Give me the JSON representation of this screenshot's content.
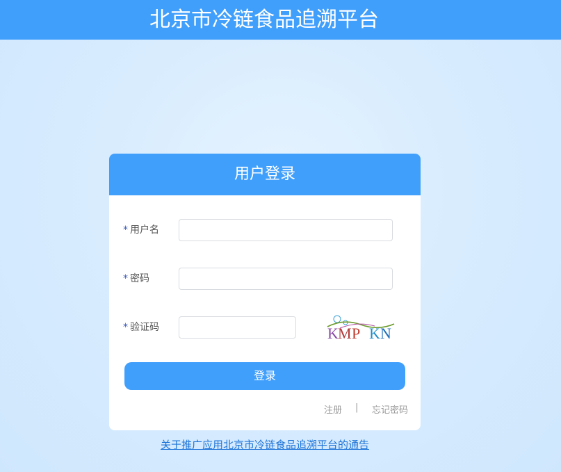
{
  "header": {
    "title": "北京市冷链食品追溯平台"
  },
  "login_card": {
    "title": "用户登录",
    "required_mark": "*",
    "username": {
      "label": "用户名",
      "value": "",
      "placeholder": ""
    },
    "password": {
      "label": "密码",
      "value": "",
      "placeholder": ""
    },
    "captcha": {
      "label": "验证码",
      "value": "",
      "placeholder": "",
      "image_text": "KMP KN"
    },
    "submit_label": "登录",
    "register_link": "注册",
    "separator": "|",
    "forgot_link": "忘记密码"
  },
  "notice_link": "关于推广应用北京市冷链食品追溯平台的通告",
  "colors": {
    "primary": "#419ffc",
    "background": "#d8ecfe",
    "link": "#1e74d8",
    "required": "#3a5bb8"
  }
}
